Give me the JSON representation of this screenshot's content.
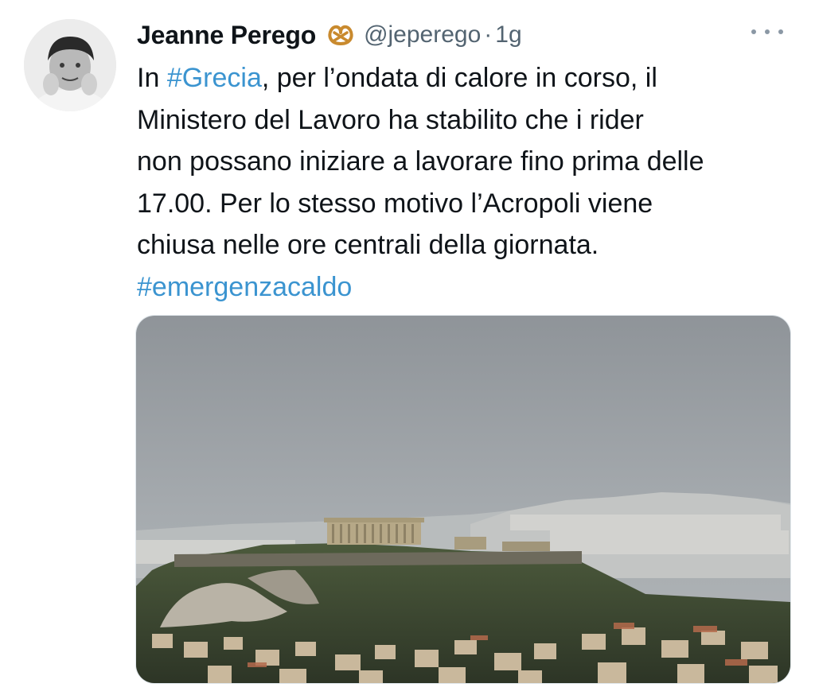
{
  "tweet": {
    "author_name": "Jeanne Perego",
    "badge_icon": "pretzel-icon",
    "handle": "@jeperego",
    "separator": "·",
    "time": "1g",
    "more_icon": "more-dots-icon",
    "text": {
      "l1_pre": "In ",
      "l1_tag": "#Grecia",
      "l1_post": ", per l’ondata di calore in corso, il",
      "l2": "Ministero del Lavoro ha  stabilito che i rider",
      "l3": "non possano iniziare a lavorare fino prima delle",
      "l4": "17.00. Per lo stesso motivo l’Acropoli viene",
      "l5": "chiusa nelle ore centrali della giornata.",
      "l6_tag": "#emergenzacaldo"
    },
    "colors": {
      "hashtag": "#3b94d0",
      "secondary_text": "#536471",
      "badge": "#c98a2e"
    }
  }
}
